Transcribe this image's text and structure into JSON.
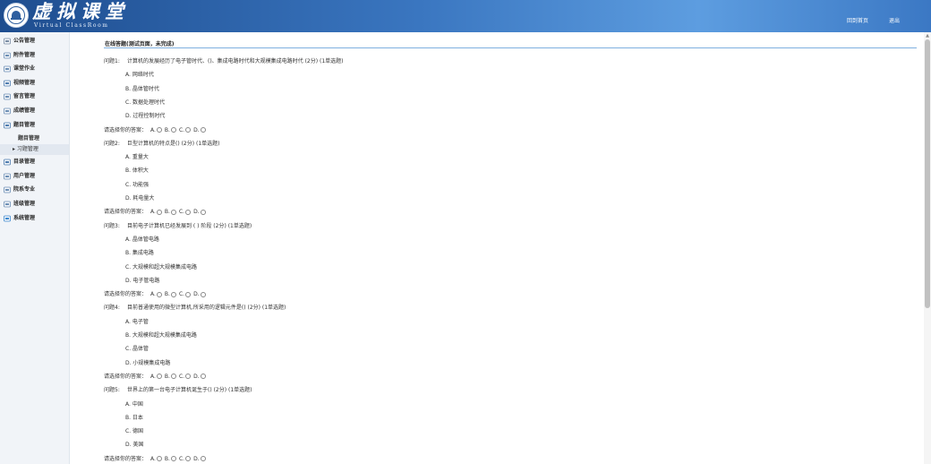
{
  "header": {
    "title": "虚拟课堂",
    "subtitle": "Virtual ClassRoom",
    "nav_home": "回到首页",
    "nav_logout": "退出"
  },
  "sidebar": {
    "items": [
      {
        "label": "公告管理",
        "icon": "announcement-icon"
      },
      {
        "label": "附件管理",
        "icon": "attachment-icon"
      },
      {
        "label": "课堂作业",
        "icon": "pencil-icon"
      },
      {
        "label": "视频管理",
        "icon": "video-icon"
      },
      {
        "label": "留言管理",
        "icon": "message-icon"
      },
      {
        "label": "成绩管理",
        "icon": "grade-icon"
      },
      {
        "label": "题目管理",
        "icon": "question-icon"
      }
    ],
    "subitems": [
      {
        "label": "题目管理"
      },
      {
        "label": "▸ 习题管理"
      }
    ],
    "items2": [
      {
        "label": "目录管理",
        "icon": "list-icon"
      },
      {
        "label": "用户管理",
        "icon": "users-icon"
      },
      {
        "label": "院系专业",
        "icon": "department-icon"
      },
      {
        "label": "班级管理",
        "icon": "class-icon"
      },
      {
        "label": "系统管理",
        "icon": "system-icon"
      }
    ]
  },
  "page": {
    "title": "在线答题(测试页面，未完成)",
    "answer_prompt": "请选择你的答案：",
    "choices": [
      "A.",
      "B.",
      "C.",
      "D."
    ]
  },
  "questions": [
    {
      "num": "问题1:",
      "text": "计算机的发展经历了电子管时代、()、集成电路时代和大规模集成电路时代 (2分) (1单选题)",
      "options": [
        "A. 网络时代",
        "B. 晶体管时代",
        "C. 数据处理时代",
        "D. 过程控制时代"
      ]
    },
    {
      "num": "问题2:",
      "text": "巨型计算机的特点是() (2分) (1单选题)",
      "options": [
        "A. 重量大",
        "B. 体积大",
        "C. 功能强",
        "D. 耗电量大"
      ]
    },
    {
      "num": "问题3:",
      "text": "目前电子计算机已经发展到 ( ) 阶段 (2分) (1单选题)",
      "options": [
        "A. 晶体管电路",
        "B. 集成电路",
        "C. 大规模和超大规模集成电路",
        "D. 电子管电路"
      ]
    },
    {
      "num": "问题4:",
      "text": "目前普通使用的微型计算机,所采用的逻辑元件是() (2分) (1单选题)",
      "options": [
        "A. 电子管",
        "B. 大规模和超大规模集成电路",
        "C. 晶体管",
        "D. 小规模集成电路"
      ]
    },
    {
      "num": "问题5:",
      "text": "世界上的第一台电子计算机诞生于() (2分) (1单选题)",
      "options": [
        "A. 中国",
        "B. 日本",
        "C. 德国",
        "D. 美国"
      ]
    }
  ]
}
